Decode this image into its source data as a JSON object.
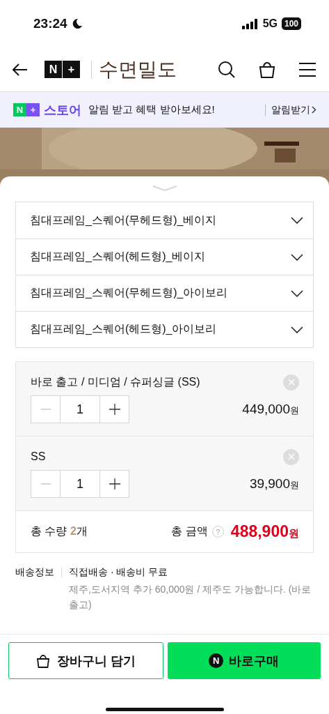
{
  "status_bar": {
    "time": "23:24",
    "network": "5G",
    "battery": "100"
  },
  "header": {
    "badge_n": "N",
    "badge_plus": "+",
    "store_name": "수면밀도"
  },
  "banner": {
    "badge_n": "N",
    "badge_plus": "+",
    "store": "스토어",
    "message": "알림 받고 혜택 받아보세요!",
    "action": "알림받기"
  },
  "options": [
    {
      "label": "침대프레임_스퀘어(무헤드형)_베이지",
      "expanded": false
    },
    {
      "label": "침대프레임_스퀘어(헤드형)_베이지",
      "expanded": false
    },
    {
      "label": "침대프레임_스퀘어(무헤드형)_아이보리",
      "expanded": false
    },
    {
      "label": "침대프레임_스퀘어(헤드형)_아이보리",
      "expanded": false
    }
  ],
  "selected_items": [
    {
      "name": "바로 출고 / 미디엄 / 슈퍼싱글 (SS)",
      "quantity": "1",
      "price": "449,000",
      "currency": "원"
    },
    {
      "name": "SS",
      "quantity": "1",
      "price": "39,900",
      "currency": "원"
    }
  ],
  "total": {
    "quantity_label": "총 수량",
    "quantity": "2",
    "quantity_unit": "개",
    "amount_label": "총 금액",
    "help": "?",
    "amount": "488,900",
    "currency": "원"
  },
  "shipping": {
    "label": "배송정보",
    "method": "직접배송 · 배송비 무료",
    "note": "제주,도서지역 추가 60,000원 / 제주도 가능합니다. (바로 출고)"
  },
  "actions": {
    "cart": "장바구니 담기",
    "buy_badge": "N",
    "buy": "바로구매"
  }
}
